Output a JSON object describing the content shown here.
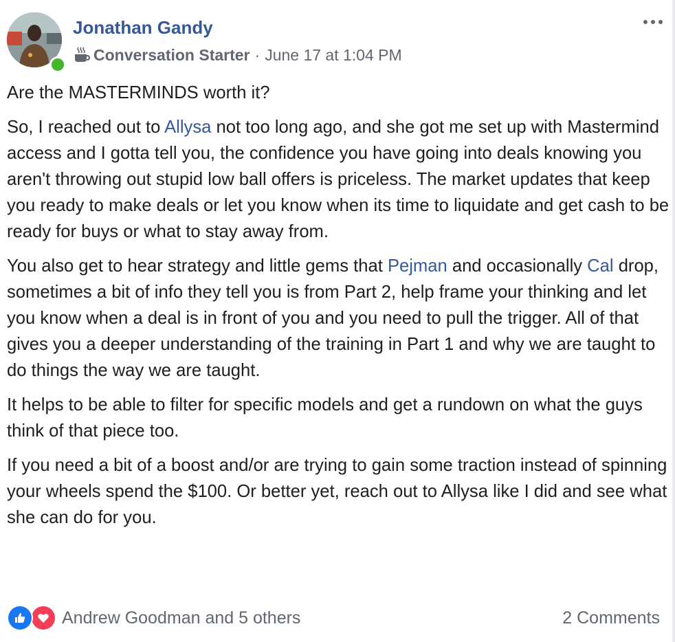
{
  "post": {
    "author": "Jonathan Gandy",
    "badge": {
      "icon": "coffee-cup-icon",
      "label": "Conversation Starter"
    },
    "separator": "·",
    "timestamp": "June 17 at 1:04 PM",
    "title": "Are the MASTERMINDS worth it?",
    "paragraph1": {
      "part1": "So, I reached out to ",
      "mention": "Allysa",
      "part2": " not too long ago, and she got me set up with Mastermind access and I gotta tell you, the confidence you have going into deals knowing you aren't throwing out stupid low ball offers is priceless. The market updates that keep you ready to make deals or let you know when its time to liquidate and get cash to be ready for buys or what to stay away from."
    },
    "paragraph2": {
      "part1": "You also get to hear strategy and little gems that ",
      "mention1": "Pejman",
      "part2": " and occasionally ",
      "mention2": "Cal",
      "part3": " drop, sometimes a bit of info they tell you is from Part 2, help frame your thinking and let you know when a deal is in front of you and you need to pull the trigger. All of that gives you a deeper understanding of the training in Part 1 and why we are taught to do things the way we are taught."
    },
    "paragraph3": "It helps to be able to filter for specific models and get a rundown on what the guys think of that piece too.",
    "paragraph4": "If you need a bit of a boost and/or are trying to gain some traction instead of spinning your wheels spend the $100. Or better yet, reach out to Allysa like I did and see what she can do for you."
  },
  "footer": {
    "reaction_icons": [
      "like-icon",
      "love-icon"
    ],
    "reaction_text": "Andrew Goodman and 5 others",
    "comments": "2 Comments"
  },
  "colors": {
    "link": "#365899",
    "text": "#1c1e21",
    "meta": "#616770",
    "online": "#42b72a",
    "like": "#1877f2",
    "love": "#f33e58"
  }
}
